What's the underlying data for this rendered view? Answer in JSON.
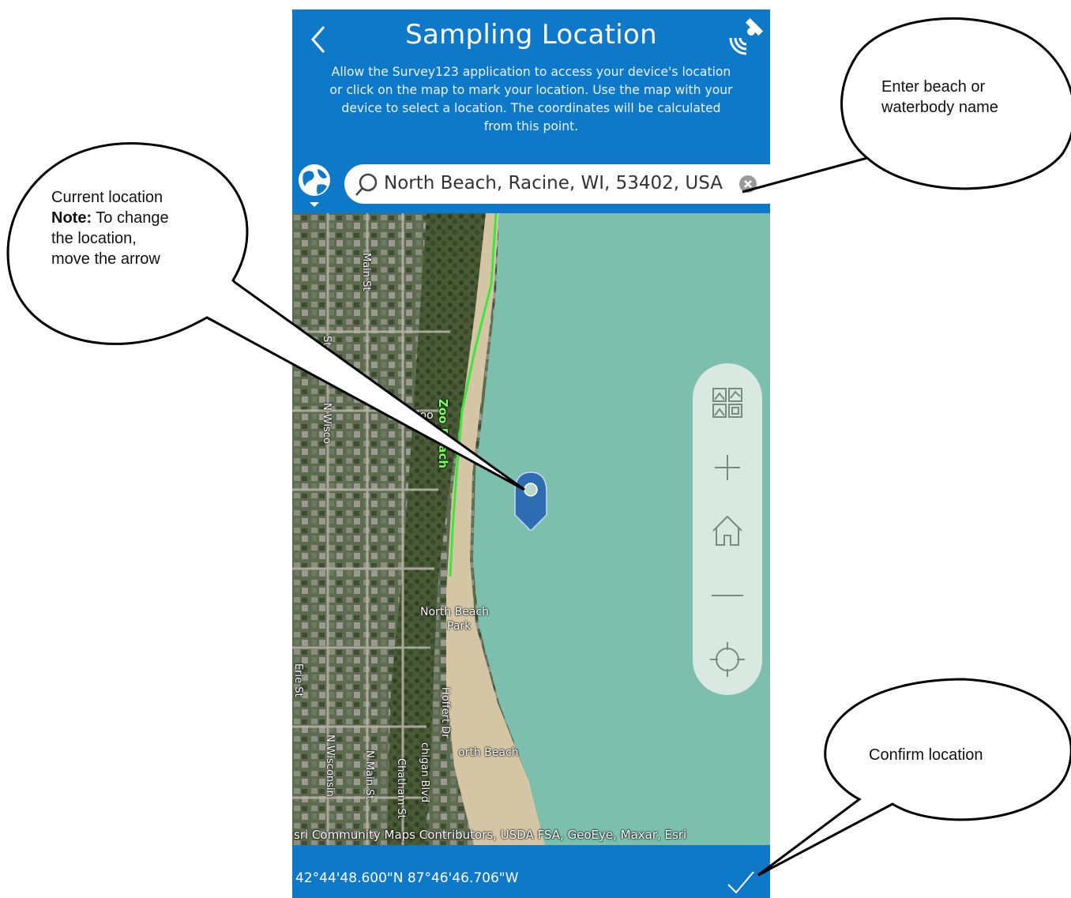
{
  "header": {
    "title": "Sampling Location",
    "instructions": "Allow the Survey123 application to access your device's location\nor click on the map to mark your location. Use the map with your\ndevice to select a location. The coordinates will be calculated\nfrom this point."
  },
  "search": {
    "value": "North Beach, Racine, WI, 53402, USA"
  },
  "map": {
    "labels": {
      "main_st_top": "Main St",
      "wisconsin_top": "N Wisco",
      "st_left": "St",
      "zoo_beach": "Zoo Beach",
      "zoo": "ne Zoo",
      "north_beach_park_1": "North Beach",
      "north_beach_park_2": "Park",
      "erie_st": "Erie St",
      "hoffert_dr": "Hoffert Dr",
      "north_beach": "orth Beach",
      "wisconsin_bottom": "N Wisconsin",
      "main_st_bottom": "N Main St",
      "chatham_st": "Chatham St",
      "michigan_blvd": "chigan Blvd"
    },
    "attribution": "sri Community Maps Contributors, USDA FSA, GeoEye, Maxar, Esri"
  },
  "controls": [
    "basemap-icon",
    "zoom-in-icon",
    "home-icon",
    "zoom-out-icon",
    "locate-icon"
  ],
  "footer": {
    "coordinates": "42°44'48.600\"N 87°46'46.706\"W"
  },
  "callouts": {
    "current_location_line1": "Current location",
    "note_label": "Note:",
    "note_rest": " To change",
    "current_location_line3": "the location,",
    "current_location_line4": "move the arrow",
    "search_line1": "Enter beach or",
    "search_line2": "waterbody name",
    "confirm": "Confirm location"
  },
  "colors": {
    "header_blue": "#0f79c9",
    "water": "#72b8a6",
    "pin": "#2f6db3"
  }
}
